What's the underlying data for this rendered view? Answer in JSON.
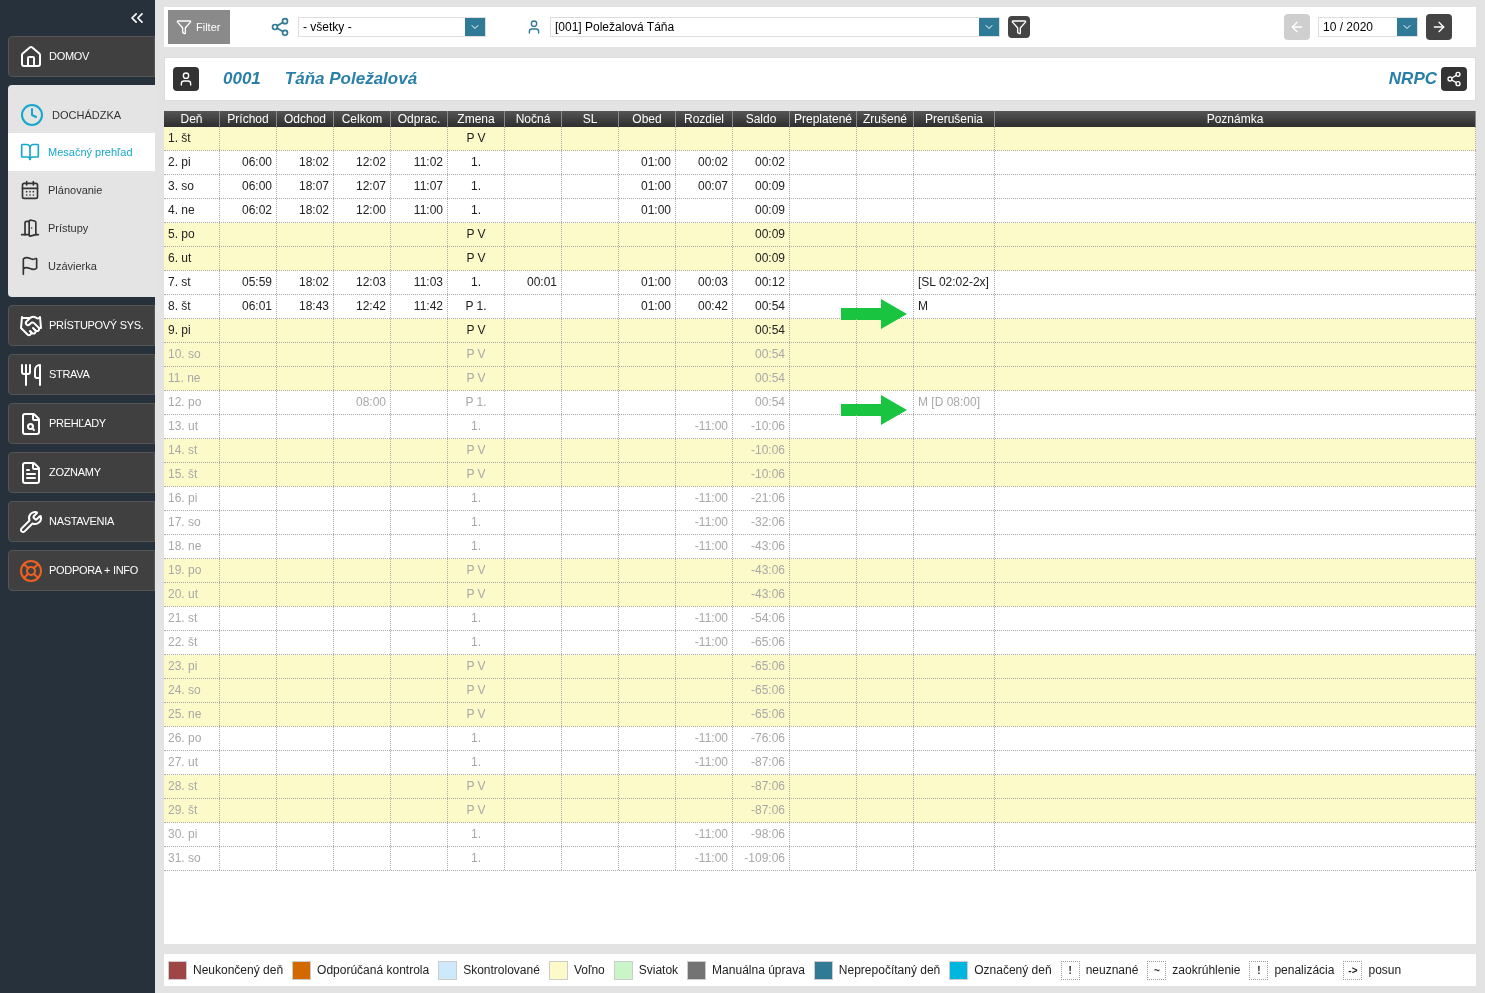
{
  "sidebar": {
    "items": [
      {
        "label": "DOMOV",
        "expanded": false
      },
      {
        "label": "DOCHÁDZKA",
        "expanded": true,
        "children": [
          {
            "label": "Mesačný prehľad",
            "selected": true
          },
          {
            "label": "Plánovanie",
            "selected": false
          },
          {
            "label": "Prístupy",
            "selected": false
          },
          {
            "label": "Uzávierka",
            "selected": false
          }
        ]
      },
      {
        "label": "PRÍSTUPOVÝ SYS.",
        "expanded": false
      },
      {
        "label": "STRAVA",
        "expanded": false
      },
      {
        "label": "PREHĽADY",
        "expanded": false
      },
      {
        "label": "ZOZNAMY",
        "expanded": false
      },
      {
        "label": "NASTAVENIA",
        "expanded": false
      },
      {
        "label": "PODPORA + INFO",
        "expanded": false
      }
    ]
  },
  "toolbar": {
    "filter_button": "Filter",
    "group_select": "- všetky -",
    "person_select": "[001] Poležalová Táňa",
    "prev_disabled": true,
    "month": "10 / 2020"
  },
  "employee": {
    "number": "0001",
    "name": "Táňa Poležalová",
    "unit": "NRPC"
  },
  "table": {
    "columns": [
      "Deň",
      "Príchod",
      "Odchod",
      "Celkom",
      "Odprac.",
      "Zmena",
      "Nočná",
      "SL",
      "Obed",
      "Rozdiel",
      "Saldo",
      "Preplatené",
      "Zrušené",
      "Prerušenia",
      "Poznámka"
    ],
    "rows": [
      {
        "day": "1. št",
        "shift": "P V",
        "free": true,
        "future": false,
        "marked": false
      },
      {
        "day": "2. pi",
        "arrival": "06:00",
        "departure": "18:02",
        "total": "12:02",
        "worked": "11:02",
        "shift": "1.",
        "lunch": "01:00",
        "diff": "00:02",
        "balance": "00:02",
        "free": false,
        "future": false,
        "marked": false
      },
      {
        "day": "3. so",
        "arrival": "06:00",
        "departure": "18:07",
        "total": "12:07",
        "worked": "11:07",
        "shift": "1.",
        "lunch": "01:00",
        "diff": "00:07",
        "balance": "00:09",
        "free": false,
        "future": false,
        "marked": false
      },
      {
        "day": "4. ne",
        "arrival": "06:02",
        "departure": "18:02",
        "total": "12:00",
        "worked": "11:00",
        "shift": "1.",
        "lunch": "01:00",
        "balance": "00:09",
        "free": false,
        "future": false,
        "marked": false
      },
      {
        "day": "5. po",
        "shift": "P V",
        "balance": "00:09",
        "free": true,
        "future": false,
        "marked": false
      },
      {
        "day": "6. ut",
        "shift": "P V",
        "balance": "00:09",
        "free": true,
        "future": false,
        "marked": false
      },
      {
        "day": "7. st",
        "arrival": "05:59",
        "departure": "18:02",
        "total": "12:03",
        "worked": "11:03",
        "shift": "1.",
        "night": "00:01",
        "lunch": "01:00",
        "diff": "00:03",
        "balance": "00:12",
        "breaks": "[SL 02:02-2x]",
        "free": false,
        "future": false,
        "marked": false
      },
      {
        "day": "8. št",
        "arrival": "06:01",
        "departure": "18:43",
        "total": "12:42",
        "worked": "11:42",
        "shift": "P 1.",
        "lunch": "01:00",
        "diff": "00:42",
        "balance": "00:54",
        "breaks": "M",
        "free": false,
        "future": false,
        "marked": true
      },
      {
        "day": "9. pi",
        "shift": "P V",
        "balance": "00:54",
        "free": true,
        "future": false,
        "marked": false
      },
      {
        "day": "10. so",
        "shift": "P V",
        "balance": "00:54",
        "free": true,
        "future": true,
        "marked": false
      },
      {
        "day": "11. ne",
        "shift": "P V",
        "balance": "00:54",
        "free": true,
        "future": true,
        "marked": false
      },
      {
        "day": "12. po",
        "total": "08:00",
        "shift": "P 1.",
        "balance": "00:54",
        "breaks": "M [D 08:00]",
        "free": false,
        "future": true,
        "marked": true
      },
      {
        "day": "13. ut",
        "shift": "1.",
        "diff": "-11:00",
        "balance": "-10:06",
        "free": false,
        "future": true,
        "marked": false
      },
      {
        "day": "14. st",
        "shift": "P V",
        "balance": "-10:06",
        "free": true,
        "future": true,
        "marked": false
      },
      {
        "day": "15. št",
        "shift": "P V",
        "balance": "-10:06",
        "free": true,
        "future": true,
        "marked": false
      },
      {
        "day": "16. pi",
        "shift": "1.",
        "diff": "-11:00",
        "balance": "-21:06",
        "free": false,
        "future": true,
        "marked": false
      },
      {
        "day": "17. so",
        "shift": "1.",
        "diff": "-11:00",
        "balance": "-32:06",
        "free": false,
        "future": true,
        "marked": false
      },
      {
        "day": "18. ne",
        "shift": "1.",
        "diff": "-11:00",
        "balance": "-43:06",
        "free": false,
        "future": true,
        "marked": false
      },
      {
        "day": "19. po",
        "shift": "P V",
        "balance": "-43:06",
        "free": true,
        "future": true,
        "marked": false
      },
      {
        "day": "20. ut",
        "shift": "P V",
        "balance": "-43:06",
        "free": true,
        "future": true,
        "marked": false
      },
      {
        "day": "21. st",
        "shift": "1.",
        "diff": "-11:00",
        "balance": "-54:06",
        "free": false,
        "future": true,
        "marked": false
      },
      {
        "day": "22. št",
        "shift": "1.",
        "diff": "-11:00",
        "balance": "-65:06",
        "free": false,
        "future": true,
        "marked": false
      },
      {
        "day": "23. pi",
        "shift": "P V",
        "balance": "-65:06",
        "free": true,
        "future": true,
        "marked": false
      },
      {
        "day": "24. so",
        "shift": "P V",
        "balance": "-65:06",
        "free": true,
        "future": true,
        "marked": false
      },
      {
        "day": "25. ne",
        "shift": "P V",
        "balance": "-65:06",
        "free": true,
        "future": true,
        "marked": false
      },
      {
        "day": "26. po",
        "shift": "1.",
        "diff": "-11:00",
        "balance": "-76:06",
        "free": false,
        "future": true,
        "marked": false
      },
      {
        "day": "27. ut",
        "shift": "1.",
        "diff": "-11:00",
        "balance": "-87:06",
        "free": false,
        "future": true,
        "marked": false
      },
      {
        "day": "28. st",
        "shift": "P V",
        "balance": "-87:06",
        "free": true,
        "future": true,
        "marked": false
      },
      {
        "day": "29. št",
        "shift": "P V",
        "balance": "-87:06",
        "free": true,
        "future": true,
        "marked": false
      },
      {
        "day": "30. pi",
        "shift": "1.",
        "diff": "-11:00",
        "balance": "-98:06",
        "free": false,
        "future": true,
        "marked": false
      },
      {
        "day": "31. so",
        "shift": "1.",
        "diff": "-11:00",
        "balance": "-109:06",
        "free": false,
        "future": true,
        "marked": false
      }
    ]
  },
  "legend": [
    {
      "kind": "swatch",
      "label": "Neukončený deň",
      "color": "#a04545"
    },
    {
      "kind": "swatch",
      "label": "Odporúčaná kontrola",
      "color": "#d26a00"
    },
    {
      "kind": "swatch",
      "label": "Skontrolované",
      "color": "#cde9fb"
    },
    {
      "kind": "swatch",
      "label": "Voľno",
      "color": "#fdfac9"
    },
    {
      "kind": "swatch",
      "label": "Sviatok",
      "color": "#c9f5c9"
    },
    {
      "kind": "swatch",
      "label": "Manuálna úprava",
      "color": "#737373"
    },
    {
      "kind": "swatch",
      "label": "Neprepočítaný deň",
      "color": "#307a96"
    },
    {
      "kind": "swatch",
      "label": "Označený deň",
      "color": "#00b5de"
    },
    {
      "kind": "symbol",
      "symbol": "!",
      "label": "neuznané"
    },
    {
      "kind": "symbol",
      "symbol": "~",
      "label": "zaokrúhlenie"
    },
    {
      "kind": "symbol",
      "symbol": "!",
      "label": "penalizácia"
    },
    {
      "kind": "symbol",
      "symbol": "->",
      "label": "posun"
    }
  ]
}
